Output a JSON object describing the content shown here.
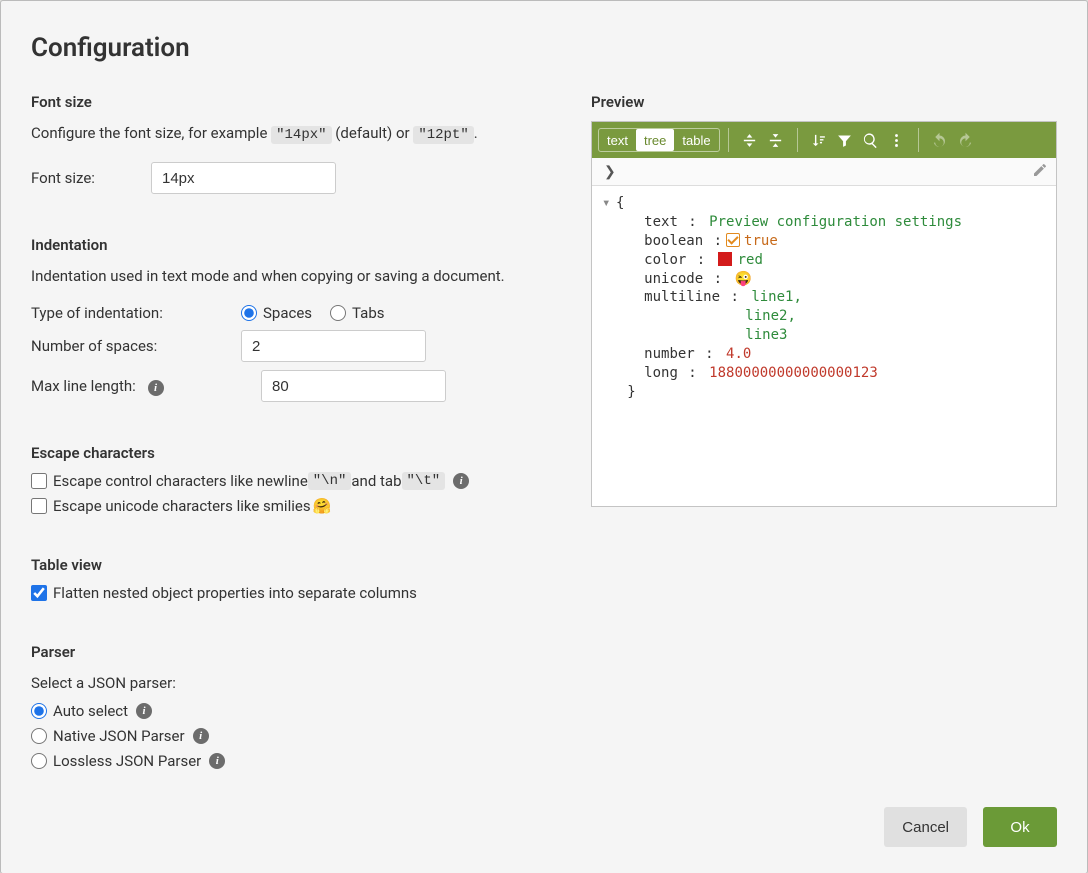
{
  "title": "Configuration",
  "fontSize": {
    "heading": "Font size",
    "desc_pre": "Configure the font size, for example ",
    "example1": "\"14px\"",
    "desc_mid": " (default) or ",
    "example2": "\"12pt\"",
    "desc_post": ".",
    "label": "Font size:",
    "value": "14px"
  },
  "indentation": {
    "heading": "Indentation",
    "desc": "Indentation used in text mode and when copying or saving a document.",
    "typeLabel": "Type of indentation:",
    "option_spaces": "Spaces",
    "option_tabs": "Tabs",
    "numberLabel": "Number of spaces:",
    "numberValue": "2",
    "maxLineLabel": "Max line length:",
    "maxLineValue": "80"
  },
  "escape": {
    "heading": "Escape characters",
    "line1_pre": "Escape control characters like newline ",
    "line1_code1": "\"\\n\"",
    "line1_mid": " and tab ",
    "line1_code2": "\"\\t\"",
    "line2_pre": "Escape unicode characters like smilies ",
    "line2_emoji": "🤗"
  },
  "tableView": {
    "heading": "Table view",
    "label": "Flatten nested object properties into separate columns"
  },
  "parser": {
    "heading": "Parser",
    "desc": "Select a JSON parser:",
    "auto": "Auto select",
    "native": "Native JSON Parser",
    "lossless": "Lossless JSON Parser"
  },
  "preview": {
    "heading": "Preview",
    "modes": {
      "text": "text",
      "tree": "tree",
      "table": "table"
    },
    "data": {
      "text_key": "text",
      "text_val": "Preview configuration settings",
      "bool_key": "boolean",
      "bool_val": "true",
      "color_key": "color",
      "color_val": "red",
      "unicode_key": "unicode",
      "unicode_val": "😜",
      "multiline_key": "multiline",
      "multiline_l1": "line1,",
      "multiline_l2": "line2,",
      "multiline_l3": "line3",
      "number_key": "number",
      "number_val": "4.0",
      "long_key": "long",
      "long_val": "18800000000000000123"
    }
  },
  "buttons": {
    "cancel": "Cancel",
    "ok": "Ok"
  }
}
